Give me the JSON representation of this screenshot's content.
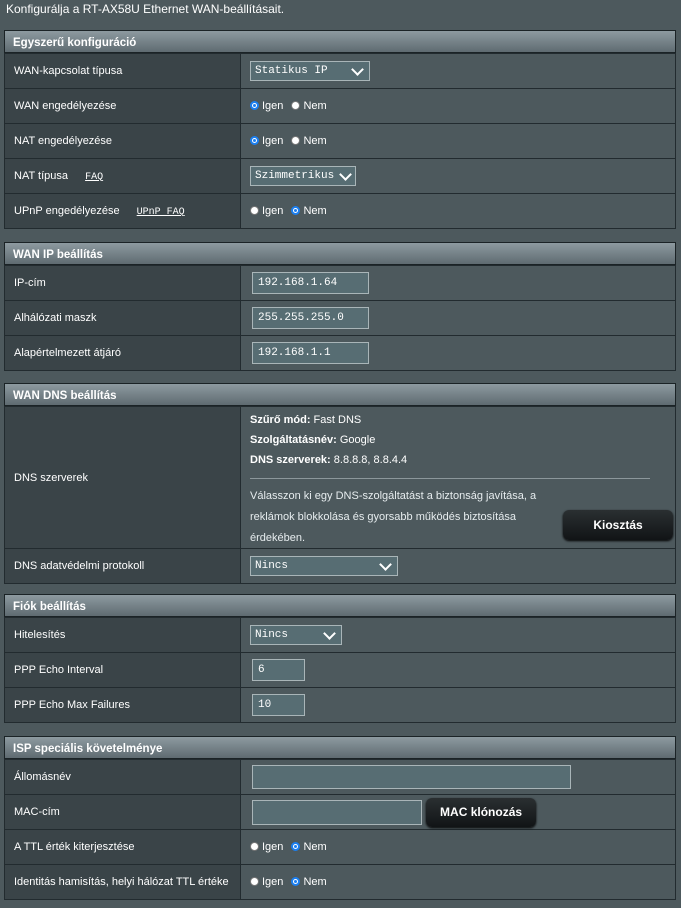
{
  "page_title": "Konfigurálja a RT-AX58U Ethernet WAN-beállításait.",
  "basic": {
    "title": "Egyszerű konfiguráció",
    "wan_type_label": "WAN-kapcsolat típusa",
    "wan_type_value": "Statikus IP",
    "wan_enable_label": "WAN engedélyezése",
    "nat_enable_label": "NAT engedélyezése",
    "nat_type_label": "NAT típusa",
    "nat_faq": "FAQ",
    "nat_type_value": "Szimmetrikus",
    "upnp_label": "UPnP engedélyezése",
    "upnp_faq": "UPnP  FAQ",
    "yes": "Igen",
    "no": "Nem",
    "wan_enable": "yes",
    "nat_enable": "yes",
    "upnp": "no"
  },
  "wan_ip": {
    "title": "WAN IP beállítás",
    "ip_label": "IP-cím",
    "ip_value": "192.168.1.64",
    "mask_label": "Alhálózati maszk",
    "mask_value": "255.255.255.0",
    "gateway_label": "Alapértelmezett átjáró",
    "gateway_value": "192.168.1.1"
  },
  "wan_dns": {
    "title": "WAN DNS beállítás",
    "servers_label": "DNS szerverek",
    "filter_mode_key": "Szűrő mód:",
    "filter_mode_value": " Fast DNS",
    "service_name_key": "Szolgáltatásnév:",
    "service_name_value": " Google",
    "servers_key": "DNS szerverek:",
    "servers_value": " 8.8.8.8, 8.8.4.4",
    "description": "Válasszon ki egy DNS-szolgáltatást a biztonság javítása, a reklámok blokkolása és gyorsabb működés biztosítása érdekében.",
    "assign_button": "Kiosztás",
    "privacy_label": "DNS adatvédelmi protokoll",
    "privacy_value": "Nincs"
  },
  "account": {
    "title": "Fiók beállítás",
    "auth_label": "Hitelesítés",
    "auth_value": "Nincs",
    "echo_interval_label": "PPP Echo Interval",
    "echo_interval_value": "6",
    "echo_max_label": "PPP Echo Max Failures",
    "echo_max_value": "10"
  },
  "isp": {
    "title": "ISP speciális követelménye",
    "hostname_label": "Állomásnév",
    "hostname_value": "",
    "mac_label": "MAC-cím",
    "mac_value": "",
    "mac_clone_button": "MAC klónozás",
    "ttl_extend_label": "A TTL érték kiterjesztése",
    "ttl_spoof_label": "Identitás hamisítás, helyi hálózat TTL értéke",
    "yes": "Igen",
    "no": "Nem",
    "ttl_extend": "no",
    "ttl_spoof": "no"
  }
}
